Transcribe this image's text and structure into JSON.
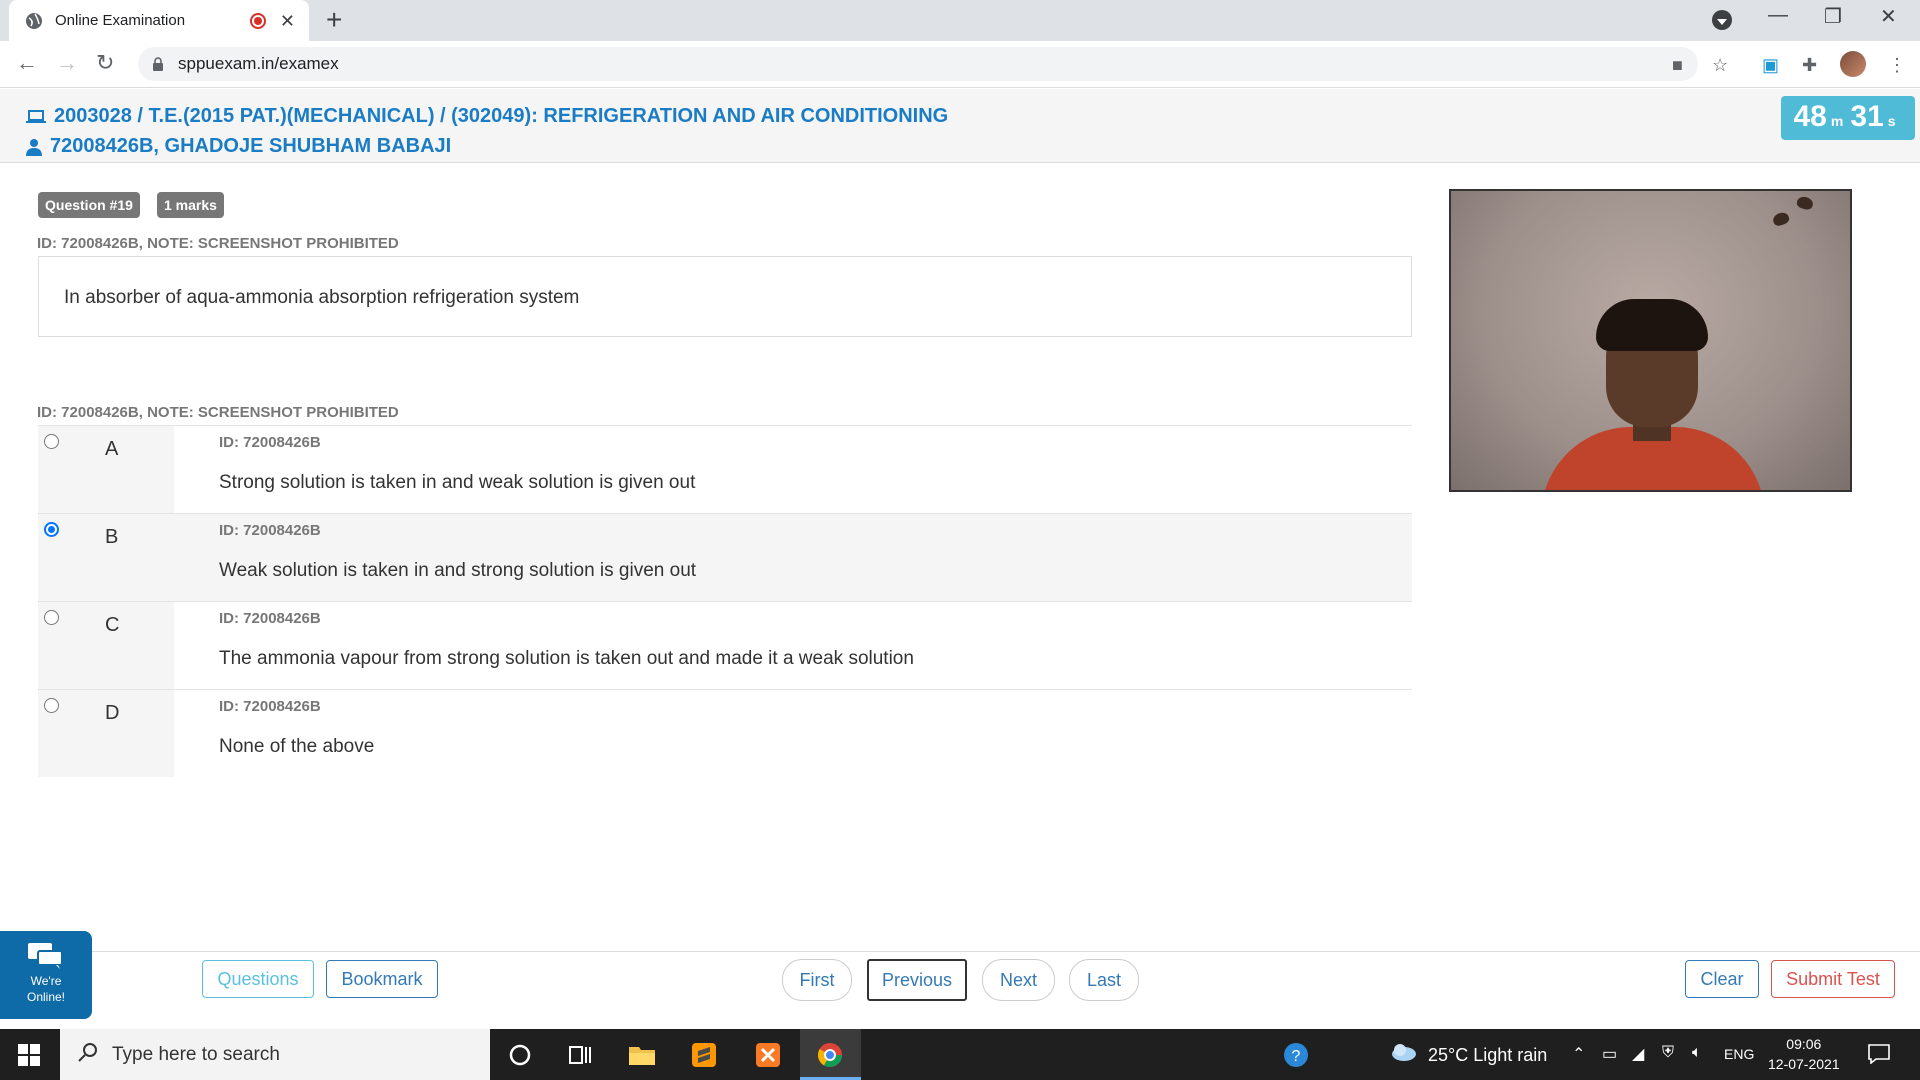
{
  "browser": {
    "tab_title": "Online Examination",
    "url": "sppuexam.in/examex"
  },
  "exam": {
    "course": "2003028 / T.E.(2015 PAT.)(MECHANICAL) / (302049): REFRIGERATION AND AIR CONDITIONING",
    "student": "72008426B, GHADOJE SHUBHAM BABAJI",
    "timer": {
      "minutes": "48",
      "minutes_unit": "m",
      "seconds": "31",
      "seconds_unit": "s"
    }
  },
  "question": {
    "number_badge": "Question #19",
    "marks_badge": "1 marks",
    "note": "ID: 72008426B, NOTE: SCREENSHOT PROHIBITED",
    "text": "In absorber of aqua-ammonia absorption refrigeration system",
    "options_note": "ID: 72008426B, NOTE: SCREENSHOT PROHIBITED",
    "selected": "B",
    "options": [
      {
        "letter": "A",
        "id": "ID: 72008426B",
        "text": "Strong solution is taken in and weak solution is given out"
      },
      {
        "letter": "B",
        "id": "ID: 72008426B",
        "text": "Weak solution is taken in and strong solution is given out"
      },
      {
        "letter": "C",
        "id": "ID: 72008426B",
        "text": "The ammonia vapour from strong solution is taken out and made it a weak solution"
      },
      {
        "letter": "D",
        "id": "ID: 72008426B",
        "text": "None of the above"
      }
    ]
  },
  "toolbar": {
    "questions": "Questions",
    "bookmark": "Bookmark",
    "first": "First",
    "previous": "Previous",
    "next": "Next",
    "last": "Last",
    "clear": "Clear",
    "submit": "Submit Test"
  },
  "chat_widget": {
    "line1": "We're",
    "line2": "Online!"
  },
  "taskbar": {
    "search_placeholder": "Type here to search",
    "weather": "25°C  Light rain",
    "language": "ENG",
    "time": "09:06",
    "date": "12-07-2021"
  },
  "colors": {
    "header_blue": "#1a7cc4",
    "timer_bg": "#4fbbd6",
    "badge_gray": "#777777",
    "danger": "#d9534f",
    "primary": "#337ab7",
    "info": "#5bc0de"
  }
}
